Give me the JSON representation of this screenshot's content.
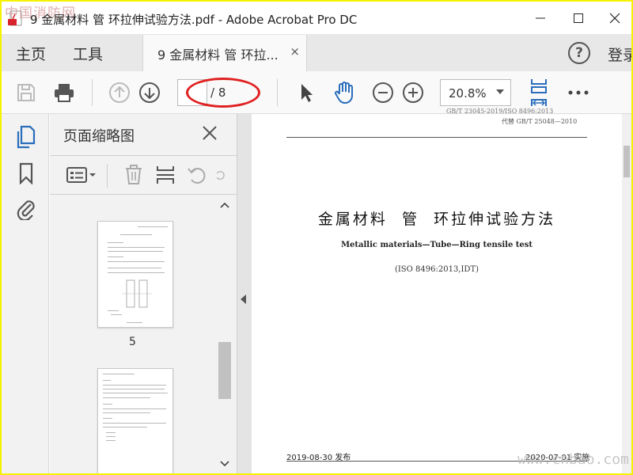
{
  "watermarks": {
    "top_left": "中国消防网",
    "bottom_right": "www.cnbao.com"
  },
  "window": {
    "title": "9 金属材料 管 环拉伸试验方法.pdf - Adobe Acrobat Pro DC",
    "controls": [
      "minimize",
      "maximize",
      "close"
    ]
  },
  "tabs": {
    "home": "主页",
    "tools": "工具",
    "document": "9 金属材料 管 环拉...",
    "close": "×",
    "help": "?",
    "login": "登录"
  },
  "toolbar": {
    "current_page": "",
    "total_pages": "/ 8",
    "zoom": "20.8%"
  },
  "left_rail": {
    "icons": [
      "page-thumbnails-icon",
      "bookmark-icon",
      "attachment-icon"
    ]
  },
  "thumbnail_panel": {
    "title": "页面缩略图",
    "pages": [
      {
        "label": "5"
      },
      {
        "label": ""
      }
    ]
  },
  "document": {
    "header_cut": "GB/T 23045-2019/ISO 8496:2013",
    "replaces": "代替 GB/T 25048—2010",
    "title": "金属材料  管  环拉伸试验方法",
    "english_title": "Metallic materials—Tube—Ring tensile test",
    "iso_ref": "(ISO 8496:2013,IDT)",
    "publish_date": "2019-08-30 发布",
    "implement_date": "2020-07-01 实施"
  },
  "colors": {
    "accent_blue": "#2a6ebb",
    "annotation_red": "#e02020",
    "border_yellow": "#f5f200"
  }
}
